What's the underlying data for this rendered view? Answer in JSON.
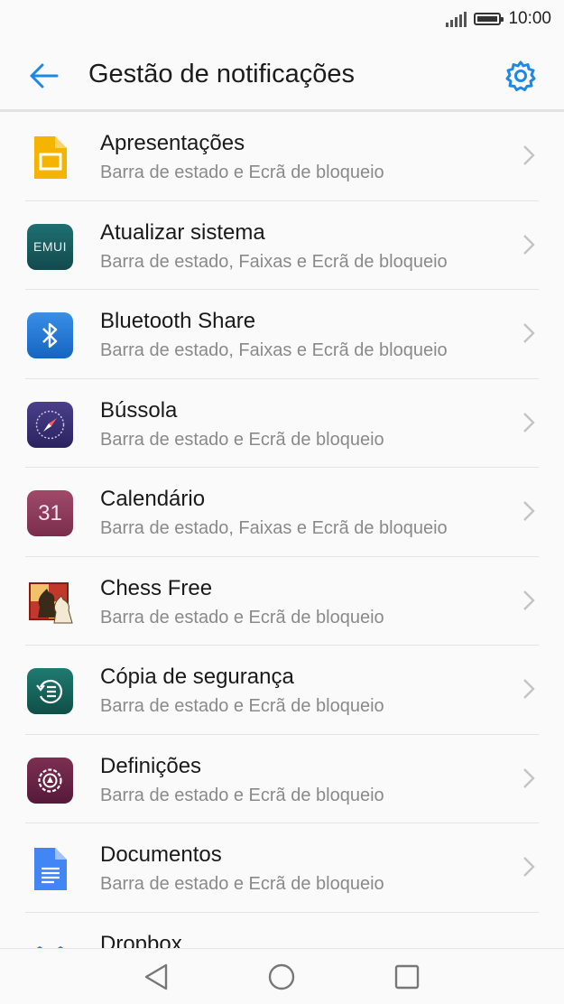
{
  "status_bar": {
    "time": "10:00"
  },
  "header": {
    "title": "Gestão de notificações"
  },
  "apps": [
    {
      "name": "Apresentações",
      "subtitle": "Barra de estado e Ecrã de bloqueio",
      "icon": "slides-icon"
    },
    {
      "name": "Atualizar sistema",
      "subtitle": "Barra de estado, Faixas e Ecrã de bloqueio",
      "icon": "emui-icon",
      "icon_text": "EMUI"
    },
    {
      "name": "Bluetooth Share",
      "subtitle": "Barra de estado, Faixas e Ecrã de bloqueio",
      "icon": "bluetooth-icon"
    },
    {
      "name": "Bússola",
      "subtitle": "Barra de estado e Ecrã de bloqueio",
      "icon": "compass-icon"
    },
    {
      "name": "Calendário",
      "subtitle": "Barra de estado, Faixas e Ecrã de bloqueio",
      "icon": "calendar-icon",
      "icon_text": "31"
    },
    {
      "name": "Chess Free",
      "subtitle": "Barra de estado e Ecrã de bloqueio",
      "icon": "chess-icon"
    },
    {
      "name": "Cópia de segurança",
      "subtitle": "Barra de estado e Ecrã de bloqueio",
      "icon": "backup-icon"
    },
    {
      "name": "Definições",
      "subtitle": "Barra de estado e Ecrã de bloqueio",
      "icon": "settings-app-icon"
    },
    {
      "name": "Documentos",
      "subtitle": "Barra de estado e Ecrã de bloqueio",
      "icon": "docs-icon"
    },
    {
      "name": "Dropbox",
      "subtitle": "",
      "icon": "dropbox-icon"
    }
  ],
  "colors": {
    "accent": "#1e88e5",
    "chevron": "#c4c4c4",
    "subtitle": "#8a8a8a"
  }
}
